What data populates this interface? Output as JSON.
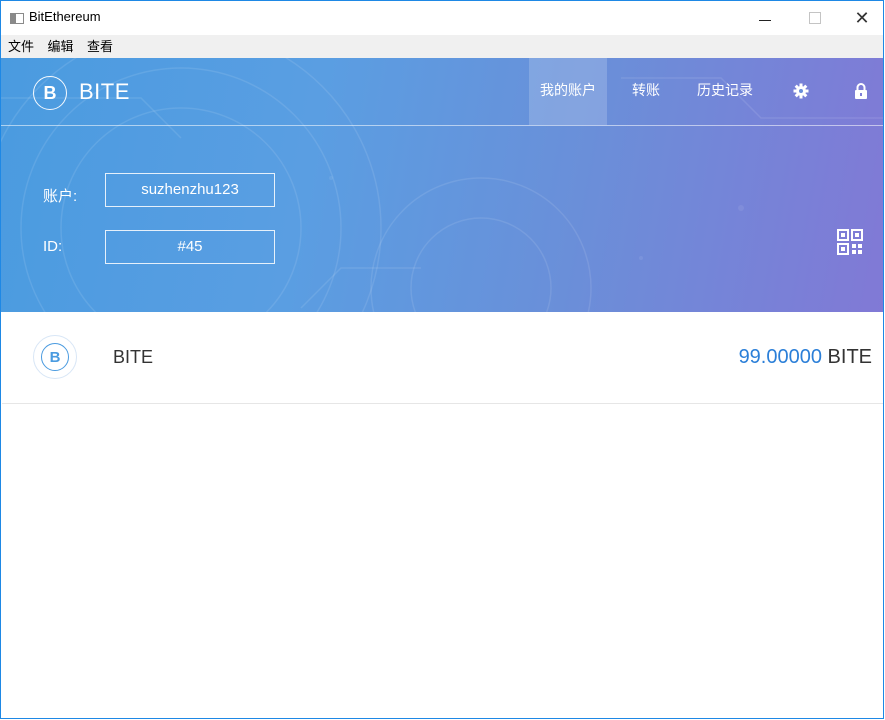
{
  "window": {
    "title": "BitEthereum",
    "controls": {
      "minimize": "—",
      "maximize": "□",
      "close": "✕"
    }
  },
  "menu": [
    "文件",
    "编辑",
    "查看"
  ],
  "header": {
    "logo_letter": "B",
    "brand": "BITE",
    "nav": [
      {
        "label": "我的账户",
        "active": true
      },
      {
        "label": "转账",
        "active": false
      },
      {
        "label": "历史记录",
        "active": false
      }
    ],
    "icons": {
      "settings": "gear-icon",
      "lock": "lock-icon",
      "qr": "qr-code-icon"
    },
    "account_label": "账户:",
    "account_value": "suzhenzhu123",
    "id_label": "ID:",
    "id_value": "#45",
    "gradient": [
      "#4a9be0",
      "#8179d6"
    ]
  },
  "assets": [
    {
      "logo_letter": "B",
      "name": "BITE",
      "amount": "99.00000",
      "unit": "BITE"
    }
  ],
  "colors": {
    "accent": "#2b7fd8",
    "window_border": "#1e88e5"
  }
}
